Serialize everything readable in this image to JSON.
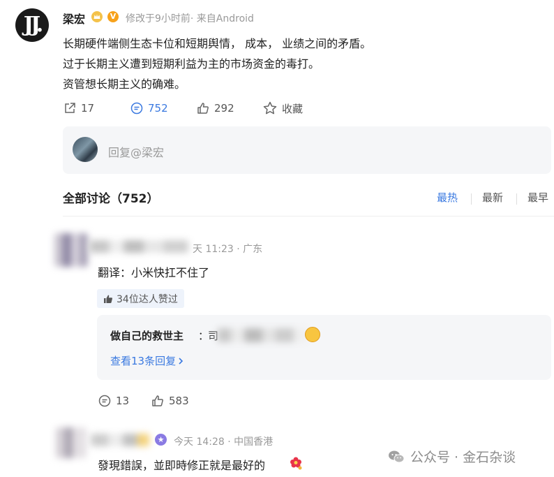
{
  "post": {
    "author": "梁宏",
    "meta": "修改于9小时前· 来自Android",
    "lines": [
      "长期硬件端侧生态卡位和短期舆情， 成本， 业绩之间的矛盾。",
      "过于长期主义遭到短期利益为主的市场资金的毒打。",
      "资管想长期主义的确难。"
    ],
    "actions": {
      "share_count": "17",
      "comment_count": "752",
      "like_count": "292",
      "favorite_label": "收藏"
    }
  },
  "reply_box": {
    "placeholder": "回复@梁宏"
  },
  "discussion": {
    "title": "全部讨论（752）",
    "sort_tabs": {
      "hot": "最热",
      "new": "最新",
      "early": "最早"
    }
  },
  "comments": [
    {
      "meta": "天 11:23 · 广东",
      "text": "翻译：小米快扛不住了",
      "likes_tag": "34位达人赞过",
      "sub_reply": {
        "author": "做自己的救世主",
        "colon": "：",
        "visible_start": "司",
        "more": "查看13条回复"
      },
      "reply_count": "13",
      "like_count": "583"
    },
    {
      "meta": "今天 14:28 · 中国香港",
      "text": "發現錯誤，並即時修正就是最好的"
    }
  ],
  "watermark": "公众号 · 金石杂谈",
  "colors": {
    "accent": "#3a79e0",
    "muted": "#999999",
    "panel": "#f5f6f8"
  }
}
